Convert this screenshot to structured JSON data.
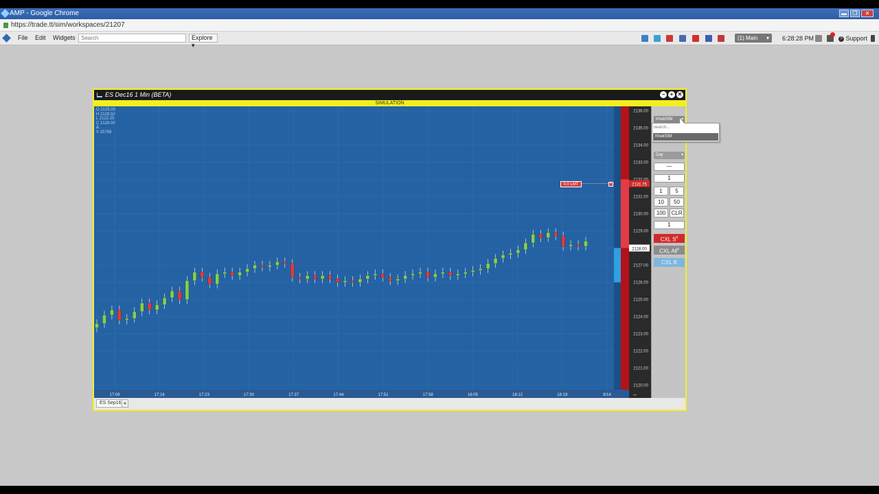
{
  "browser": {
    "window_title": "AMP - Google Chrome",
    "url": "https://trade.tt/sim/workspaces/21207",
    "win_buttons": [
      "▬",
      "❐",
      "✕"
    ]
  },
  "appbar": {
    "menu": [
      "File",
      "Edit",
      "Widgets"
    ],
    "search_placeholder": "Search",
    "explore_label": "Explore ▾",
    "workspace": "(1) Main",
    "workspace_caret": "▾",
    "time": "6:28:28 PM",
    "support_label": "Support",
    "toolbar_colors": [
      "#3b82c4",
      "#3ca0d8",
      "#c83a3a",
      "#4a6ab0",
      "#d03030",
      "#3a60b0",
      "#c03a3a"
    ]
  },
  "widget": {
    "title": "ES Dec16 1 Min (BETA)",
    "mode": "SIMULATION",
    "controls": [
      "−",
      "+",
      "✕"
    ],
    "ohlc": [
      "O 2125.00",
      "H 2128.50",
      "L 2122.25",
      "C 2128.00",
      "Δ",
      "V 25768"
    ],
    "tab": "ES Sep16",
    "tab_add": "+",
    "order_label": "0.0 LMT",
    "order_cancel": "×",
    "scroll_arrow": "→"
  },
  "order_entry": {
    "account": "KhekSIM",
    "account_caret": "▾",
    "account_search_placeholder": "Search...",
    "account_option": "KhekSIM",
    "tif": "Day",
    "tif_caret": "▾",
    "price_field": "—",
    "qty": "1",
    "qty_buttons": [
      "1",
      "5",
      "10",
      "50",
      "100",
      "CLR"
    ],
    "qty_display": "1",
    "cxl_sell": "CXL S",
    "cxl_all": "CXL All",
    "cxl_buy": "CXL B",
    "cxl_sup": "0"
  },
  "chart_data": {
    "type": "candlestick",
    "instrument": "ES Dec16",
    "interval": "1 Min",
    "y_ticks": [
      "2136.00",
      "2135.00",
      "2134.00",
      "2133.00",
      "2132.00",
      "2131.00",
      "2130.00",
      "2129.00",
      "2128.00",
      "2127.00",
      "2126.00",
      "2125.00",
      "2124.00",
      "2123.00",
      "2122.00",
      "2121.00",
      "2120.00"
    ],
    "ylim": [
      2119.75,
      2136.25
    ],
    "x_ticks": [
      "17:09",
      "17:16",
      "17:23",
      "17:30",
      "17:37",
      "17:44",
      "17:51",
      "17:58",
      "18:05",
      "18:12",
      "18:19",
      "9/14"
    ],
    "last_price": "2128.00",
    "order_price": "2131.75",
    "limit_order_price": 2131.75,
    "bid_levels_above_ticks": 16,
    "ask_levels_below_ticks": 8,
    "closes": [
      2123.6,
      2124.1,
      2124.4,
      2123.8,
      2123.9,
      2124.3,
      2124.8,
      2124.4,
      2124.7,
      2125.1,
      2125.5,
      2125.0,
      2126.1,
      2126.6,
      2126.3,
      2125.9,
      2126.5,
      2126.6,
      2126.4,
      2126.6,
      2126.8,
      2127.0,
      2126.9,
      2127.0,
      2127.2,
      2127.1,
      2126.3,
      2126.2,
      2126.4,
      2126.2,
      2126.4,
      2126.2,
      2126.0,
      2126.1,
      2126.0,
      2126.2,
      2126.4,
      2126.5,
      2126.3,
      2126.1,
      2126.2,
      2126.4,
      2126.5,
      2126.6,
      2126.3,
      2126.5,
      2126.6,
      2126.4,
      2126.5,
      2126.6,
      2126.7,
      2126.8,
      2127.1,
      2127.4,
      2127.6,
      2127.7,
      2127.9,
      2128.3,
      2128.8,
      2128.6,
      2128.9,
      2128.7,
      2128.1,
      2128.2,
      2128.1,
      2128.4
    ]
  }
}
